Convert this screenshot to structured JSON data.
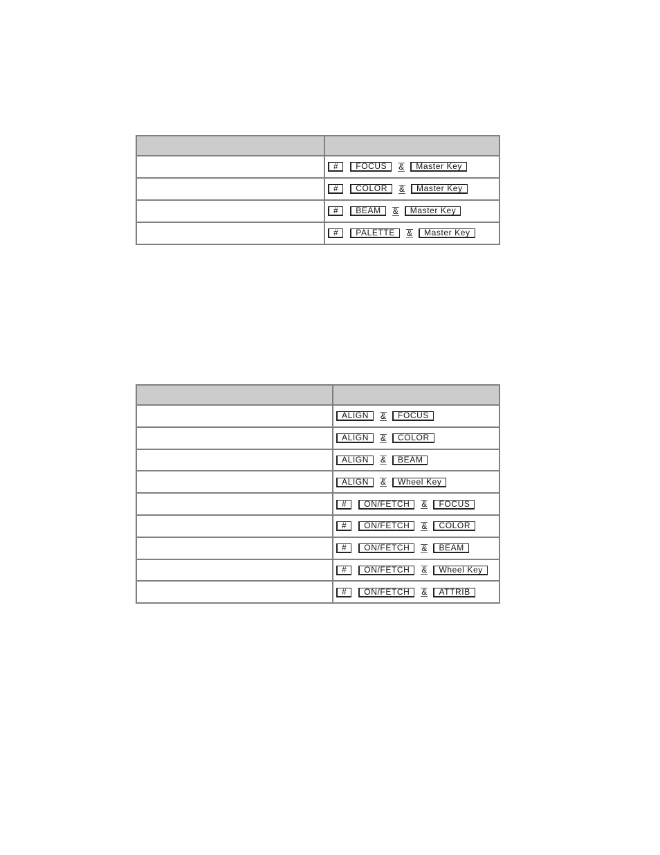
{
  "tables": [
    {
      "headers": [
        "",
        ""
      ],
      "rows": [
        {
          "label": "",
          "keys": [
            "#",
            "FOCUS",
            "&",
            "Master Key"
          ]
        },
        {
          "label": "",
          "keys": [
            "#",
            "COLOR",
            "&",
            "Master Key"
          ]
        },
        {
          "label": "",
          "keys": [
            "#",
            "BEAM",
            "&",
            "Master Key"
          ]
        },
        {
          "label": "",
          "keys": [
            "#",
            "PALETTE",
            "&",
            "Master Key"
          ]
        }
      ]
    },
    {
      "headers": [
        "",
        ""
      ],
      "rows": [
        {
          "label": "",
          "keys": [
            "ALIGN",
            "&",
            "FOCUS"
          ]
        },
        {
          "label": "",
          "keys": [
            "ALIGN",
            "&",
            "COLOR"
          ]
        },
        {
          "label": "",
          "keys": [
            "ALIGN",
            "&",
            "BEAM"
          ]
        },
        {
          "label": "",
          "keys": [
            "ALIGN",
            "&",
            "Wheel Key"
          ]
        },
        {
          "label": "",
          "keys": [
            "#",
            "ON/FETCH",
            "&",
            "FOCUS"
          ]
        },
        {
          "label": "",
          "keys": [
            "#",
            "ON/FETCH",
            "&",
            "COLOR"
          ]
        },
        {
          "label": "",
          "keys": [
            "#",
            "ON/FETCH",
            "&",
            "BEAM"
          ]
        },
        {
          "label": "",
          "keys": [
            "#",
            "ON/FETCH",
            "&",
            "Wheel Key"
          ]
        },
        {
          "label": "",
          "keys": [
            "#",
            "ON/FETCH",
            "&",
            "ATTRIB"
          ]
        }
      ]
    }
  ],
  "colors": {
    "header_bg": "#cccccc",
    "border": "#808080"
  }
}
